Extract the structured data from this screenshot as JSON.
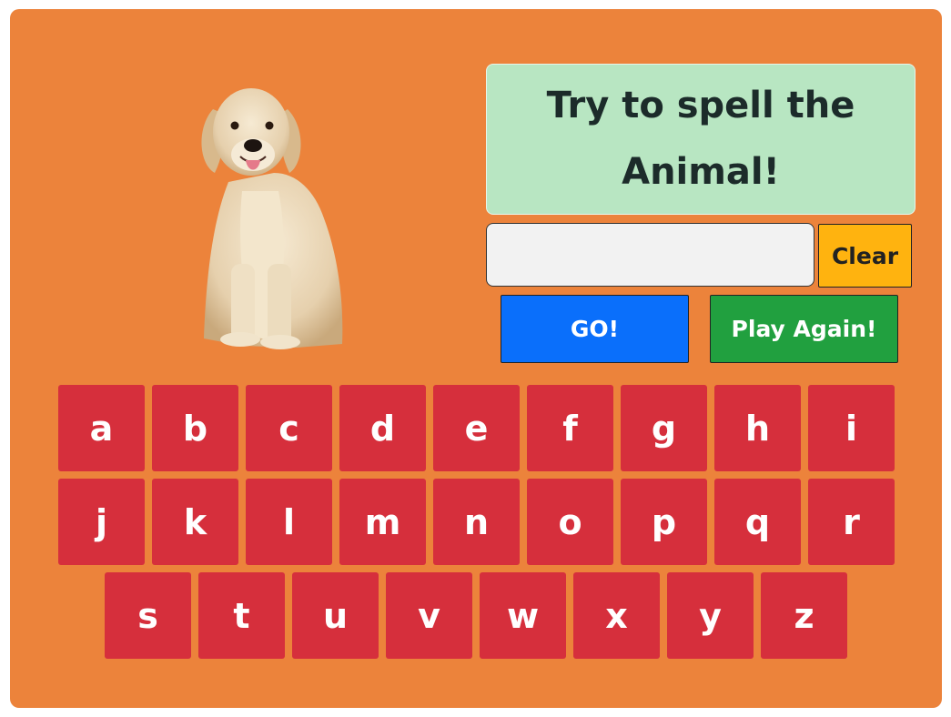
{
  "prompt": "Try to spell the Animal!",
  "answer": {
    "value": "",
    "placeholder": ""
  },
  "buttons": {
    "clear": "Clear",
    "go": "GO!",
    "play_again": "Play Again!"
  },
  "keyboard": {
    "rows": [
      [
        "a",
        "b",
        "c",
        "d",
        "e",
        "f",
        "g",
        "h",
        "i"
      ],
      [
        "j",
        "k",
        "l",
        "m",
        "n",
        "o",
        "p",
        "q",
        "r"
      ],
      [
        "s",
        "t",
        "u",
        "v",
        "w",
        "x",
        "y",
        "z"
      ]
    ]
  },
  "image": {
    "subject": "dog"
  },
  "colors": {
    "board": "#ec833b",
    "prompt_bg": "#b8e6c2",
    "key": "#d62f3c",
    "clear": "#ffb30f",
    "go": "#0a6ffb",
    "play_again": "#21a03f"
  }
}
